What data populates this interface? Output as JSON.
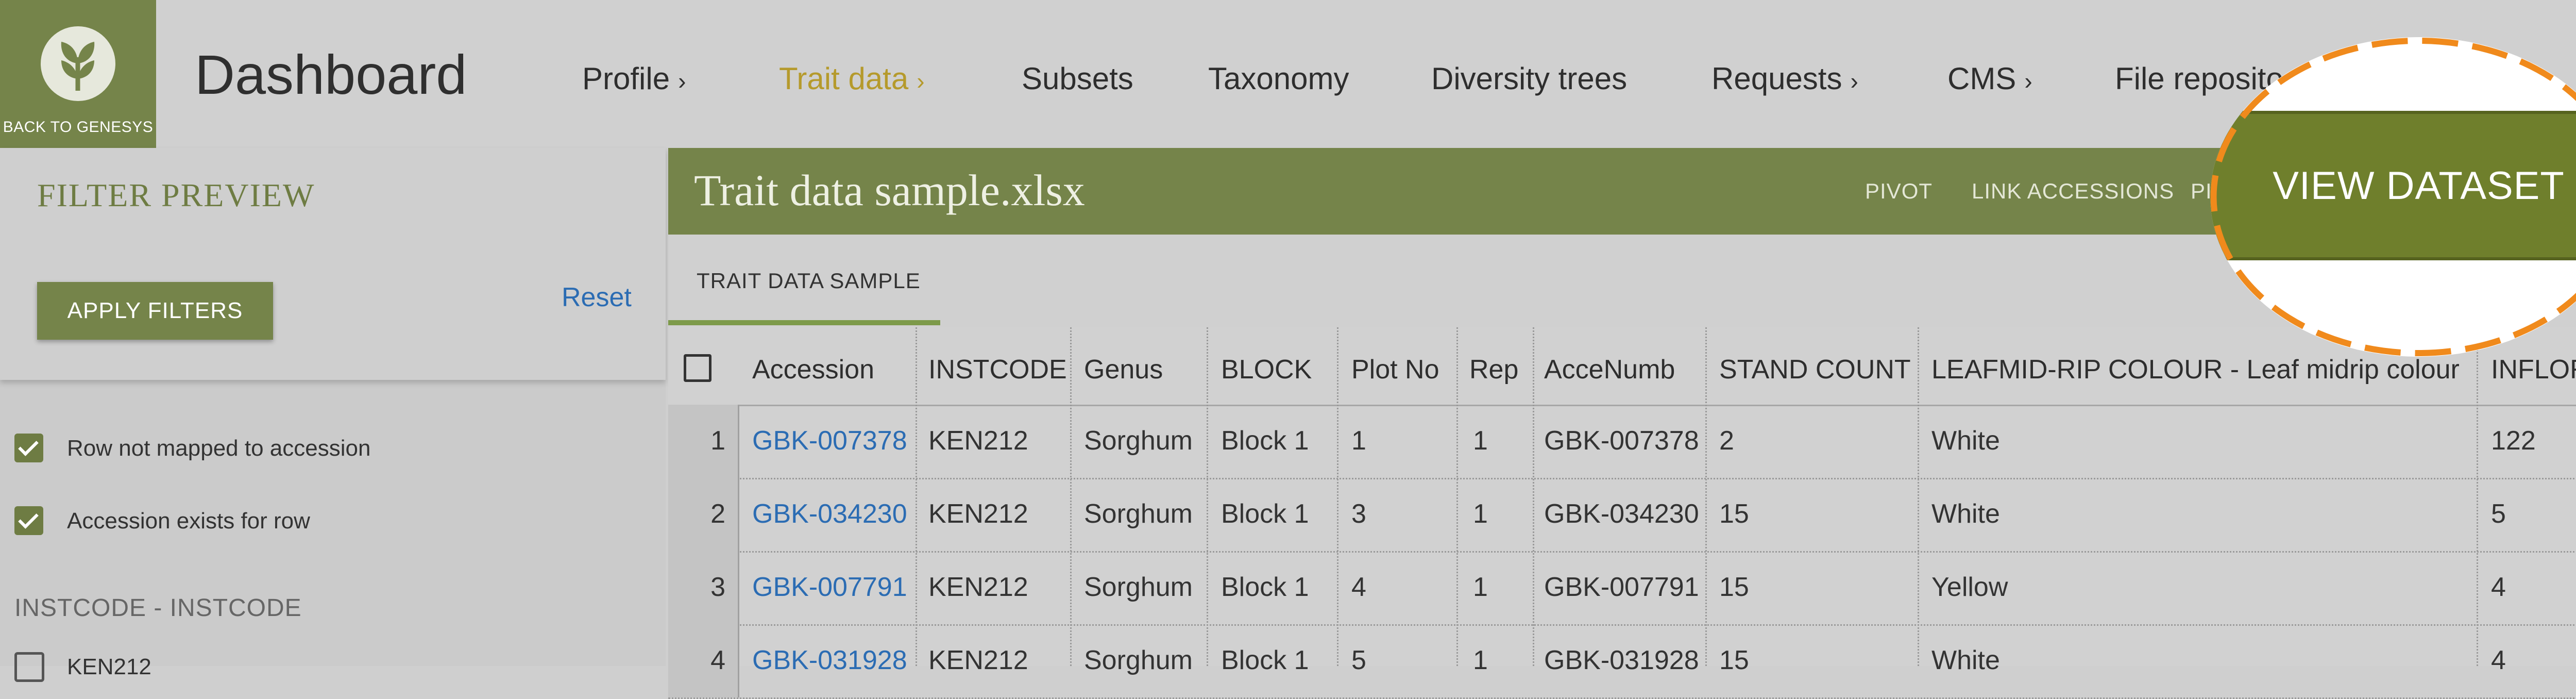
{
  "logo": {
    "back_label": "BACK TO GENESYS",
    "icon": "leaf-icon"
  },
  "header": {
    "title": "Dashboard"
  },
  "nav": [
    {
      "label": "Profile",
      "chevron": "›"
    },
    {
      "label": "Trait data",
      "chevron": "›",
      "active": true
    },
    {
      "label": "Subsets"
    },
    {
      "label": "Taxonomy"
    },
    {
      "label": "Diversity trees"
    },
    {
      "label": "Requests",
      "chevron": "›"
    },
    {
      "label": "CMS",
      "chevron": "›"
    },
    {
      "label": "File reposito"
    }
  ],
  "filter": {
    "title": "FILTER PREVIEW",
    "apply_label": "APPLY FILTERS",
    "reset_label": "Reset",
    "checks": [
      {
        "label": "Row not mapped to accession",
        "checked": true
      },
      {
        "label": "Accession exists for row",
        "checked": true
      }
    ],
    "section_title": "INSTCODE - INSTCODE",
    "section_items": [
      {
        "label": "KEN212",
        "checked": false
      }
    ]
  },
  "dataset": {
    "title": "Trait data sample.xlsx",
    "actions": [
      "PIVOT",
      "LINK ACCESSIONS",
      "PI"
    ],
    "tab": "TRAIT DATA SAMPLE"
  },
  "table": {
    "columns": [
      "Accession",
      "INSTCODE",
      "Genus",
      "BLOCK",
      "Plot No",
      "Rep",
      "AcceNumb",
      "STAND COUNT",
      "LEAFMID-RIP COLOUR - Leaf midrip colour",
      "INFLORE"
    ],
    "rows": [
      {
        "n": "1",
        "cells": [
          "GBK-007378",
          "KEN212",
          "Sorghum",
          "Block 1",
          "1",
          "1",
          "GBK-007378",
          "2",
          "White",
          "122"
        ]
      },
      {
        "n": "2",
        "cells": [
          "GBK-034230",
          "KEN212",
          "Sorghum",
          "Block 1",
          "3",
          "1",
          "GBK-034230",
          "15",
          "White",
          "5"
        ]
      },
      {
        "n": "3",
        "cells": [
          "GBK-007791",
          "KEN212",
          "Sorghum",
          "Block 1",
          "4",
          "1",
          "GBK-007791",
          "15",
          "Yellow",
          "4"
        ]
      },
      {
        "n": "4",
        "cells": [
          "GBK-031928",
          "KEN212",
          "Sorghum",
          "Block 1",
          "5",
          "1",
          "GBK-031928",
          "15",
          "White",
          "4"
        ]
      }
    ]
  },
  "spotlight": {
    "label": "VIEW DATASET",
    "ring_color": "#f08a1c"
  },
  "colors": {
    "brand": "#75844a",
    "active_nav": "#b59a2c",
    "link": "#2b6cb3"
  }
}
